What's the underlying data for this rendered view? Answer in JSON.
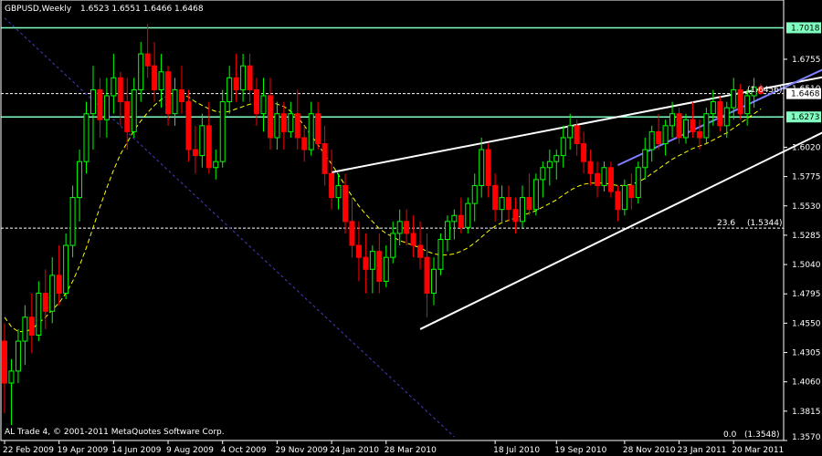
{
  "header": {
    "symbol": "GBPUSD,Weekly",
    "ohlc": "1.6523 1.6551 1.6466 1.6468"
  },
  "footer": {
    "copyright": "AL Trade 4, © 2001-2011 MetaQuotes Software Corp."
  },
  "colors": {
    "background": "#000000",
    "frame": "#ffffff",
    "bull": "#00ff00",
    "bear": "#ff0000",
    "ma": "#ffff00",
    "level_line": "#80ffc0",
    "trend_line": "#ffffff",
    "channel_line": "#8080ff",
    "diag_line": "#4040c0",
    "price_box": "#80ffc0"
  },
  "chart_data": {
    "type": "candlestick",
    "title": "GBPUSD,Weekly",
    "ylim": [
      1.357,
      1.725
    ],
    "y_ticks": [
      "1.6755",
      "1.6510",
      "1.6020",
      "1.5775",
      "1.5530",
      "1.5285",
      "1.5040",
      "1.4795",
      "1.4550",
      "1.4305",
      "1.4060",
      "1.3815",
      "1.3570"
    ],
    "x_ticks": [
      "22 Feb 2009",
      "19 Apr 2009",
      "14 Jun 2009",
      "9 Aug 2009",
      "4 Oct 2009",
      "29 Nov 2009",
      "24 Jan 2010",
      "28 Mar 2010",
      "18 Jul 2010",
      "19 Sep 2010",
      "28 Nov 2010",
      "23 Jan 2011",
      "20 Mar 2011"
    ],
    "x_tick_index": [
      0,
      8,
      16,
      24,
      32,
      40,
      48,
      56,
      72,
      81,
      91,
      99,
      107
    ],
    "grid": false,
    "candles": [
      [
        1.44,
        1.455,
        1.38,
        1.405
      ],
      [
        1.405,
        1.425,
        1.37,
        1.415
      ],
      [
        1.415,
        1.45,
        1.405,
        1.44
      ],
      [
        1.44,
        1.47,
        1.42,
        1.46
      ],
      [
        1.46,
        1.48,
        1.43,
        1.445
      ],
      [
        1.445,
        1.49,
        1.44,
        1.48
      ],
      [
        1.48,
        1.5,
        1.45,
        1.465
      ],
      [
        1.465,
        1.51,
        1.455,
        1.495
      ],
      [
        1.495,
        1.52,
        1.47,
        1.48
      ],
      [
        1.48,
        1.53,
        1.475,
        1.52
      ],
      [
        1.52,
        1.57,
        1.51,
        1.56
      ],
      [
        1.56,
        1.6,
        1.54,
        1.59
      ],
      [
        1.59,
        1.64,
        1.58,
        1.63
      ],
      [
        1.63,
        1.67,
        1.6,
        1.65
      ],
      [
        1.65,
        1.66,
        1.61,
        1.625
      ],
      [
        1.625,
        1.66,
        1.61,
        1.645
      ],
      [
        1.645,
        1.68,
        1.63,
        1.66
      ],
      [
        1.66,
        1.665,
        1.62,
        1.64
      ],
      [
        1.64,
        1.66,
        1.6,
        1.615
      ],
      [
        1.615,
        1.66,
        1.61,
        1.65
      ],
      [
        1.65,
        1.69,
        1.64,
        1.68
      ],
      [
        1.68,
        1.705,
        1.66,
        1.67
      ],
      [
        1.67,
        1.69,
        1.64,
        1.65
      ],
      [
        1.65,
        1.68,
        1.635,
        1.665
      ],
      [
        1.665,
        1.67,
        1.62,
        1.63
      ],
      [
        1.63,
        1.66,
        1.62,
        1.65
      ],
      [
        1.65,
        1.67,
        1.63,
        1.64
      ],
      [
        1.64,
        1.65,
        1.59,
        1.6
      ],
      [
        1.6,
        1.62,
        1.58,
        1.595
      ],
      [
        1.595,
        1.63,
        1.585,
        1.62
      ],
      [
        1.62,
        1.64,
        1.58,
        1.585
      ],
      [
        1.585,
        1.6,
        1.575,
        1.59
      ],
      [
        1.59,
        1.65,
        1.585,
        1.64
      ],
      [
        1.64,
        1.67,
        1.63,
        1.66
      ],
      [
        1.66,
        1.68,
        1.64,
        1.65
      ],
      [
        1.65,
        1.68,
        1.64,
        1.67
      ],
      [
        1.67,
        1.68,
        1.64,
        1.65
      ],
      [
        1.65,
        1.66,
        1.62,
        1.63
      ],
      [
        1.63,
        1.66,
        1.615,
        1.645
      ],
      [
        1.645,
        1.66,
        1.6,
        1.61
      ],
      [
        1.61,
        1.64,
        1.6,
        1.63
      ],
      [
        1.63,
        1.64,
        1.6,
        1.615
      ],
      [
        1.615,
        1.64,
        1.61,
        1.63
      ],
      [
        1.63,
        1.65,
        1.6,
        1.61
      ],
      [
        1.61,
        1.62,
        1.59,
        1.6
      ],
      [
        1.6,
        1.64,
        1.595,
        1.63
      ],
      [
        1.63,
        1.64,
        1.6,
        1.605
      ],
      [
        1.605,
        1.62,
        1.57,
        1.58
      ],
      [
        1.58,
        1.6,
        1.55,
        1.56
      ],
      [
        1.56,
        1.58,
        1.55,
        1.57
      ],
      [
        1.57,
        1.58,
        1.53,
        1.54
      ],
      [
        1.54,
        1.56,
        1.51,
        1.52
      ],
      [
        1.52,
        1.54,
        1.49,
        1.51
      ],
      [
        1.51,
        1.53,
        1.48,
        1.5
      ],
      [
        1.5,
        1.52,
        1.48,
        1.515
      ],
      [
        1.515,
        1.53,
        1.48,
        1.49
      ],
      [
        1.49,
        1.52,
        1.485,
        1.51
      ],
      [
        1.51,
        1.54,
        1.505,
        1.53
      ],
      [
        1.53,
        1.55,
        1.52,
        1.54
      ],
      [
        1.54,
        1.55,
        1.52,
        1.53
      ],
      [
        1.53,
        1.545,
        1.51,
        1.52
      ],
      [
        1.52,
        1.54,
        1.5,
        1.51
      ],
      [
        1.51,
        1.53,
        1.46,
        1.48
      ],
      [
        1.48,
        1.51,
        1.47,
        1.5
      ],
      [
        1.5,
        1.53,
        1.495,
        1.525
      ],
      [
        1.525,
        1.545,
        1.515,
        1.54
      ],
      [
        1.54,
        1.55,
        1.525,
        1.545
      ],
      [
        1.545,
        1.56,
        1.53,
        1.535
      ],
      [
        1.535,
        1.56,
        1.53,
        1.555
      ],
      [
        1.555,
        1.58,
        1.54,
        1.57
      ],
      [
        1.57,
        1.61,
        1.56,
        1.6
      ],
      [
        1.6,
        1.605,
        1.56,
        1.57
      ],
      [
        1.57,
        1.58,
        1.54,
        1.55
      ],
      [
        1.55,
        1.57,
        1.54,
        1.56
      ],
      [
        1.56,
        1.57,
        1.54,
        1.55
      ],
      [
        1.55,
        1.56,
        1.53,
        1.54
      ],
      [
        1.54,
        1.57,
        1.535,
        1.56
      ],
      [
        1.56,
        1.58,
        1.545,
        1.55
      ],
      [
        1.55,
        1.58,
        1.545,
        1.575
      ],
      [
        1.575,
        1.59,
        1.56,
        1.585
      ],
      [
        1.585,
        1.6,
        1.57,
        1.59
      ],
      [
        1.59,
        1.6,
        1.575,
        1.595
      ],
      [
        1.595,
        1.62,
        1.585,
        1.61
      ],
      [
        1.61,
        1.63,
        1.6,
        1.62
      ],
      [
        1.62,
        1.625,
        1.595,
        1.605
      ],
      [
        1.605,
        1.615,
        1.58,
        1.59
      ],
      [
        1.59,
        1.6,
        1.57,
        1.58
      ],
      [
        1.58,
        1.59,
        1.56,
        1.57
      ],
      [
        1.57,
        1.59,
        1.565,
        1.585
      ],
      [
        1.585,
        1.59,
        1.56,
        1.565
      ],
      [
        1.565,
        1.57,
        1.54,
        1.55
      ],
      [
        1.55,
        1.575,
        1.545,
        1.57
      ],
      [
        1.57,
        1.58,
        1.55,
        1.56
      ],
      [
        1.56,
        1.59,
        1.555,
        1.585
      ],
      [
        1.585,
        1.61,
        1.575,
        1.6
      ],
      [
        1.6,
        1.62,
        1.59,
        1.615
      ],
      [
        1.615,
        1.63,
        1.6,
        1.605
      ],
      [
        1.605,
        1.625,
        1.595,
        1.62
      ],
      [
        1.62,
        1.64,
        1.61,
        1.63
      ],
      [
        1.63,
        1.635,
        1.605,
        1.61
      ],
      [
        1.61,
        1.63,
        1.605,
        1.625
      ],
      [
        1.625,
        1.64,
        1.61,
        1.615
      ],
      [
        1.615,
        1.625,
        1.6,
        1.61
      ],
      [
        1.61,
        1.635,
        1.605,
        1.63
      ],
      [
        1.63,
        1.65,
        1.62,
        1.64
      ],
      [
        1.64,
        1.645,
        1.615,
        1.62
      ],
      [
        1.62,
        1.64,
        1.61,
        1.635
      ],
      [
        1.635,
        1.66,
        1.625,
        1.65
      ],
      [
        1.65,
        1.655,
        1.625,
        1.63
      ],
      [
        1.63,
        1.65,
        1.62,
        1.645
      ],
      [
        1.645,
        1.66,
        1.635,
        1.652
      ],
      [
        1.652,
        1.655,
        1.646,
        1.647
      ]
    ],
    "moving_average": [
      1.46,
      1.452,
      1.448,
      1.448,
      1.45,
      1.455,
      1.46,
      1.466,
      1.472,
      1.48,
      1.49,
      1.503,
      1.518,
      1.535,
      1.552,
      1.568,
      1.583,
      1.596,
      1.606,
      1.616,
      1.624,
      1.631,
      1.637,
      1.642,
      1.645,
      1.646,
      1.646,
      1.644,
      1.64,
      1.637,
      1.634,
      1.632,
      1.631,
      1.632,
      1.634,
      1.636,
      1.638,
      1.639,
      1.64,
      1.64,
      1.638,
      1.636,
      1.632,
      1.627,
      1.62,
      1.612,
      1.604,
      1.596,
      1.588,
      1.579,
      1.57,
      1.561,
      1.553,
      1.546,
      1.54,
      1.534,
      1.53,
      1.527,
      1.524,
      1.522,
      1.52,
      1.518,
      1.515,
      1.513,
      1.512,
      1.512,
      1.513,
      1.515,
      1.518,
      1.522,
      1.527,
      1.532,
      1.536,
      1.539,
      1.541,
      1.543,
      1.545,
      1.547,
      1.549,
      1.552,
      1.555,
      1.558,
      1.562,
      1.566,
      1.569,
      1.571,
      1.572,
      1.572,
      1.572,
      1.571,
      1.57,
      1.57,
      1.571,
      1.573,
      1.576,
      1.58,
      1.584,
      1.588,
      1.592,
      1.595,
      1.598,
      1.601,
      1.603,
      1.605,
      1.608,
      1.611,
      1.614,
      1.618,
      1.622,
      1.626,
      1.63,
      1.634
    ],
    "levels": [
      {
        "price": 1.7018,
        "label": "1.7018",
        "style": "solid"
      },
      {
        "price": 1.6273,
        "label": "1.6273",
        "style": "solid"
      },
      {
        "price": 1.6468,
        "label": "1.6468",
        "style": "dashed"
      },
      {
        "price": 1.5344,
        "style": "dashed"
      }
    ],
    "annotations": [
      {
        "text": "(1.6456)",
        "price": 1.6456
      },
      {
        "text": "23.6",
        "price": 1.5344
      },
      {
        "text": "(1.5344)",
        "price": 1.5344
      },
      {
        "text": "0.0",
        "price": 1.357
      },
      {
        "text": "(1.3548)",
        "price": 1.357
      }
    ],
    "trend_lines": [
      {
        "name": "white-upper",
        "from": [
          48,
          1.581
        ],
        "to": [
          125,
          1.666
        ]
      },
      {
        "name": "white-lower",
        "from": [
          61,
          1.45
        ],
        "to": [
          125,
          1.628
        ]
      },
      {
        "name": "blue-channel",
        "from": [
          90,
          1.587
        ],
        "to": [
          125,
          1.68
        ]
      },
      {
        "name": "diagonal",
        "from": [
          0,
          1.71
        ],
        "to": [
          66,
          1.36
        ]
      }
    ]
  }
}
